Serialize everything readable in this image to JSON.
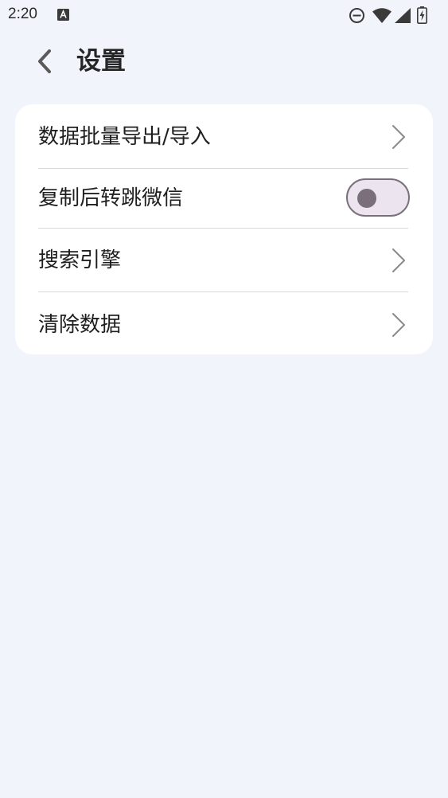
{
  "status_bar": {
    "time": "2:20",
    "icons": [
      "notification-a-icon",
      "do-not-disturb-icon",
      "wifi-icon",
      "signal-icon",
      "battery-charging-icon"
    ]
  },
  "header": {
    "back_icon": "chevron-left-icon",
    "title": "设置"
  },
  "settings": {
    "items": [
      {
        "label": "数据批量导出/导入",
        "control": "chevron-right-icon"
      },
      {
        "label": "复制后转跳微信",
        "control": "toggle",
        "toggle_on": false
      },
      {
        "label": "搜索引擎",
        "control": "chevron-right-icon"
      },
      {
        "label": "清除数据",
        "control": "chevron-right-icon"
      }
    ]
  },
  "colors": {
    "background": "#f1f4fa",
    "card": "#ffffff",
    "toggle_track": "#ece4ee",
    "toggle_border": "#7a6f7a"
  }
}
